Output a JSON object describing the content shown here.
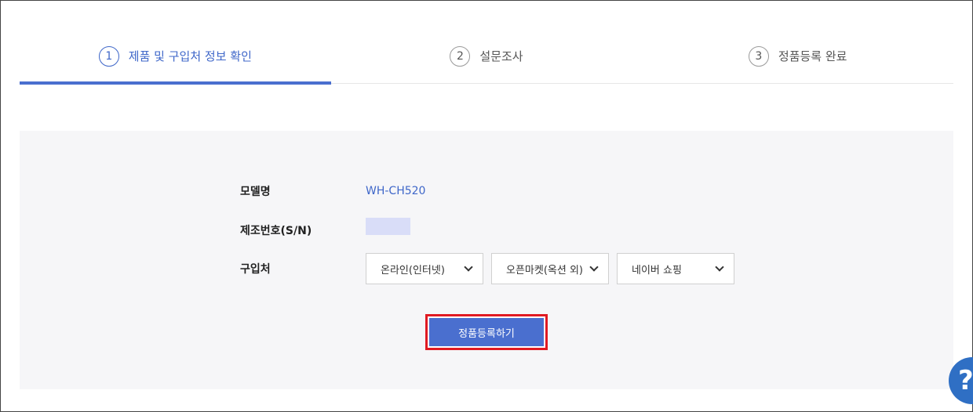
{
  "steps": [
    {
      "num": "1",
      "label": "제품 및 구입처 정보 확인",
      "active": true
    },
    {
      "num": "2",
      "label": "설문조사",
      "active": false
    },
    {
      "num": "3",
      "label": "정품등록 완료",
      "active": false
    }
  ],
  "product": {
    "model_label": "모델명",
    "model_value": "WH-CH520",
    "serial_label": "제조번호(S/N)",
    "purchase_label": "구입처"
  },
  "purchase": {
    "select1": "온라인(인터넷)",
    "select2": "오픈마켓(옥션 외)",
    "select3": "네이버 쇼핑"
  },
  "actions": {
    "register_label": "정품등록하기"
  },
  "help": {
    "icon_glyph": "?"
  },
  "colors": {
    "accent": "#4a6fcf",
    "highlight": "#e01a22",
    "panel_bg": "#f6f6f8"
  }
}
